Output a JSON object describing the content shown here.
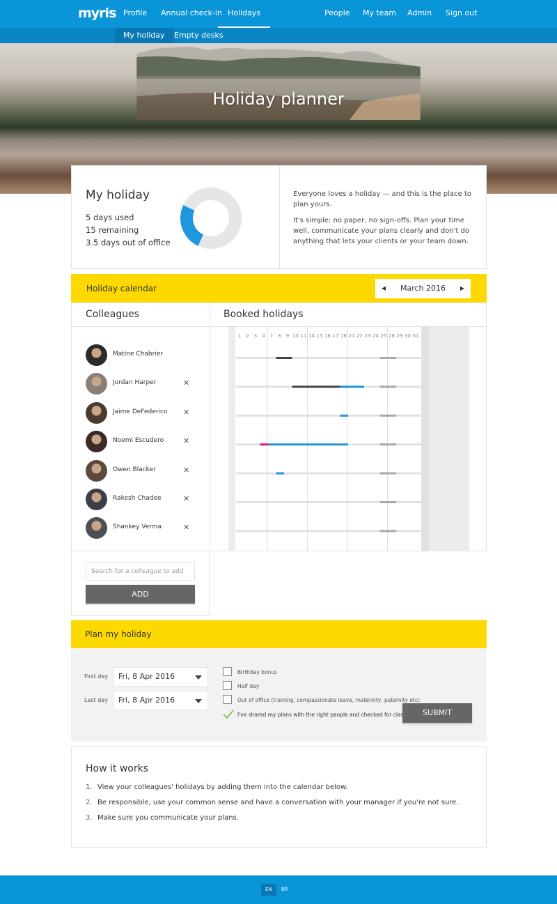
{
  "brand": {
    "logo": "myris",
    "accent": "#0b95d9",
    "highlight": "#fdd900"
  },
  "nav": {
    "left": [
      "Profile",
      "Annual check-in",
      "Holidays"
    ],
    "right": [
      "People",
      "My team",
      "Admin",
      "Sign out"
    ],
    "active": "Holidays"
  },
  "subnav": {
    "items": [
      "My holiday",
      "Empty desks"
    ],
    "active": "My holiday"
  },
  "hero": {
    "title": "Holiday planner"
  },
  "summary": {
    "title": "My holiday",
    "used": "5 days used",
    "remaining": "15 remaining",
    "out_of_office": "3.5 days out of office",
    "used_fraction": 0.25,
    "intro_1": "Everyone loves a holiday — and this is the place to plan yours.",
    "intro_2": "It's simple: no paper, no sign-offs. Plan your time well, communicate your plans clearly and don't do anything that lets your clients or your team down."
  },
  "calendar": {
    "title": "Holiday calendar",
    "month": "March 2016",
    "prev_icon": "caret-left-icon",
    "next_icon": "caret-right-icon",
    "colleagues_title": "Colleagues",
    "booked_title": "Booked holidays",
    "day_labels": [
      "1",
      "2",
      "3",
      "4",
      "7",
      "8",
      "9",
      "10",
      "11",
      "14",
      "15",
      "16",
      "17",
      "18",
      "21",
      "22",
      "23",
      "24",
      "25",
      "28",
      "29",
      "30",
      "31"
    ],
    "colleagues": [
      {
        "name": "Matine Chabrier",
        "removable": false
      },
      {
        "name": "Jordan Harper",
        "removable": true
      },
      {
        "name": "Jaime DeFederico",
        "removable": true
      },
      {
        "name": "Noemi Escudero",
        "removable": true
      },
      {
        "name": "Owen Blacker",
        "removable": true
      },
      {
        "name": "Rakesh Chadee",
        "removable": true
      },
      {
        "name": "Shankey Verma",
        "removable": true
      }
    ],
    "remove_icon": "close-icon",
    "colors": {
      "booked": "#444444",
      "approved": "#1e97dc",
      "special": "#e2197d",
      "bank_holiday": "#a9a9a9",
      "track": "#e1e1e1"
    }
  },
  "add_colleague": {
    "placeholder": "Search for a colleague to add",
    "button": "ADD"
  },
  "plan": {
    "title": "Plan my holiday",
    "first_day_label": "First day",
    "first_day_value": "Fri, 8 Apr 2016",
    "last_day_label": "Last day",
    "last_day_value": "Fri, 8 Apr 2016",
    "options": [
      "Birthday bonus",
      "Half day",
      "Out of office (training, compassionate leave, maternity, paternity etc)"
    ],
    "confirm": "I've shared my plans with the right people and checked for clashes",
    "confirm_checked": true,
    "submit": "SUBMIT"
  },
  "how": {
    "title": "How it works",
    "items": [
      {
        "num": "1.",
        "text": "View your colleagues' holidays by adding them into the calendar below."
      },
      {
        "num": "2.",
        "text": "Be responsible, use your common sense and have a conversation with your manager if you're not sure."
      },
      {
        "num": "3.",
        "text": "Make sure you communicate your plans."
      }
    ]
  },
  "footer": {
    "languages": [
      "EN",
      "BR"
    ],
    "active_language": "EN"
  }
}
